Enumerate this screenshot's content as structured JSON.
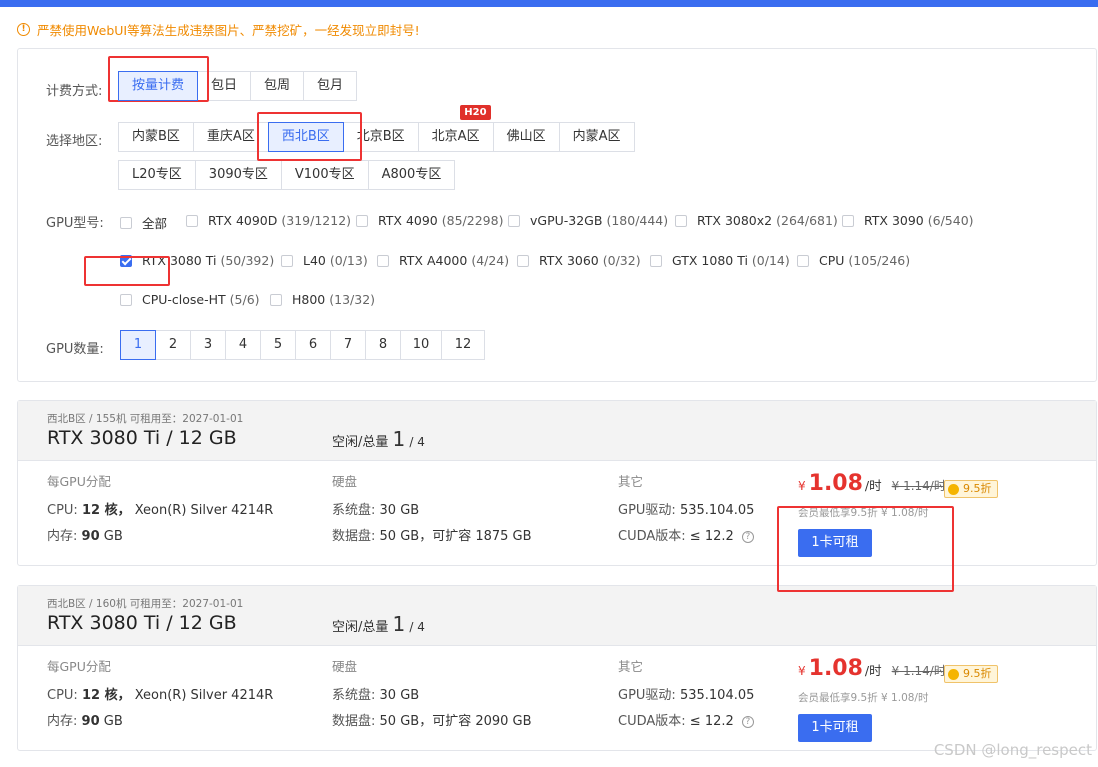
{
  "warning": {
    "icon": "alert-circle-icon",
    "text": "严禁使用WebUI等算法生成违禁图片、严禁挖矿，一经发现立即封号!"
  },
  "billing": {
    "label": "计费方式:",
    "options": [
      "按量计费",
      "包日",
      "包周",
      "包月"
    ],
    "selected": "按量计费"
  },
  "region": {
    "label": "选择地区:",
    "row1": [
      "内蒙B区",
      "重庆A区",
      "西北B区",
      "北京B区",
      "北京A区",
      "佛山区",
      "内蒙A区"
    ],
    "row2": [
      "L20专区",
      "3090专区",
      "V100专区",
      "A800专区"
    ],
    "selected": "西北B区",
    "badge": "H20"
  },
  "gpu_model": {
    "label": "GPU型号:",
    "options": [
      {
        "name": "全部",
        "count": ""
      },
      {
        "name": "RTX 4090D",
        "count": "(319/1212)"
      },
      {
        "name": "RTX 4090",
        "count": "(85/2298)"
      },
      {
        "name": "vGPU-32GB",
        "count": "(180/444)"
      },
      {
        "name": "RTX 3080x2",
        "count": "(264/681)"
      },
      {
        "name": "RTX 3090",
        "count": "(6/540)"
      },
      {
        "name": "RTX 3080 Ti",
        "count": "(50/392)"
      },
      {
        "name": "L40",
        "count": "(0/13)"
      },
      {
        "name": "RTX A4000",
        "count": "(4/24)"
      },
      {
        "name": "RTX 3060",
        "count": "(0/32)"
      },
      {
        "name": "GTX 1080 Ti",
        "count": "(0/14)"
      },
      {
        "name": "CPU",
        "count": "(105/246)"
      },
      {
        "name": "CPU-close-HT",
        "count": "(5/6)"
      },
      {
        "name": "H800",
        "count": "(13/32)"
      }
    ],
    "checked": "RTX 3080 Ti"
  },
  "gpu_count": {
    "label": "GPU数量:",
    "options": [
      "1",
      "2",
      "3",
      "4",
      "5",
      "6",
      "7",
      "8",
      "10",
      "12"
    ],
    "selected": "1"
  },
  "cards": [
    {
      "meta": "西北B区 / 155机   可租用至：2027-01-01",
      "title": "RTX 3080 Ti / 12 GB",
      "idle_label": "空闲/总量",
      "idle": "1",
      "total": "/ 4",
      "col1_header": "每GPU分配",
      "cpu_label": "CPU:",
      "cpu_value": "12 核，",
      "cpu_model": "Xeon(R) Silver 4214R",
      "mem_label": "内存:",
      "mem_value": "90",
      "mem_unit": "GB",
      "col2_header": "硬盘",
      "sys_label": "系统盘:",
      "sys_value": "30 GB",
      "data_label": "数据盘:",
      "data_value": "50 GB，可扩容 1875 GB",
      "col3_header": "其它",
      "driver_label": "GPU驱动:",
      "driver_value": "535.104.05",
      "cuda_label": "CUDA版本:",
      "cuda_value": "≤ 12.2",
      "price_currency": "¥",
      "price": "1.08",
      "price_unit": "/时",
      "old_price": "¥ 1.14/时",
      "discount": "9.5折",
      "member_note": "会员最低享9.5折 ¥ 1.08/时",
      "rent_button": "1卡可租"
    },
    {
      "meta": "西北B区 / 160机   可租用至：2027-01-01",
      "title": "RTX 3080 Ti / 12 GB",
      "idle_label": "空闲/总量",
      "idle": "1",
      "total": "/ 4",
      "col1_header": "每GPU分配",
      "cpu_label": "CPU:",
      "cpu_value": "12 核，",
      "cpu_model": "Xeon(R) Silver 4214R",
      "mem_label": "内存:",
      "mem_value": "90",
      "mem_unit": "GB",
      "col2_header": "硬盘",
      "sys_label": "系统盘:",
      "sys_value": "30 GB",
      "data_label": "数据盘:",
      "data_value": "50 GB，可扩容 2090 GB",
      "col3_header": "其它",
      "driver_label": "GPU驱动:",
      "driver_value": "535.104.05",
      "cuda_label": "CUDA版本:",
      "cuda_value": "≤ 12.2",
      "price_currency": "¥",
      "price": "1.08",
      "price_unit": "/时",
      "old_price": "¥ 1.14/时",
      "discount": "9.5折",
      "member_note": "会员最低享9.5折 ¥ 1.08/时",
      "rent_button": "1卡可租"
    }
  ],
  "watermark": "CSDN @long_respect",
  "colors": {
    "accent": "#3a6df0",
    "price": "#e5332e",
    "warning": "#f08a00",
    "highlight_box": "#ee3333"
  }
}
